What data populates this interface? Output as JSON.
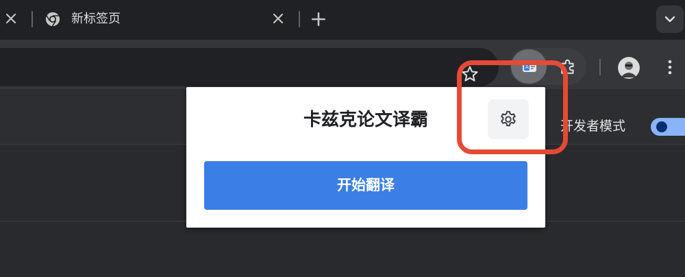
{
  "browser": {
    "tab": {
      "title": "新标签页"
    },
    "colors": {
      "frame": "#202124",
      "toolbar": "#35363a",
      "accent": "#8ab4f8"
    }
  },
  "toolbar": {
    "icons": [
      "star-icon",
      "translate-extension-icon",
      "puzzle-icon",
      "avatar",
      "more-vert-icon"
    ]
  },
  "page": {
    "dev_mode_label": "开发者模式",
    "dev_mode_on": true
  },
  "popup": {
    "title": "卡兹克论文译霸",
    "translate_button": "开始翻译",
    "button_color": "#3a7ee6"
  },
  "annotation": {
    "highlight_color": "#e54a34"
  }
}
